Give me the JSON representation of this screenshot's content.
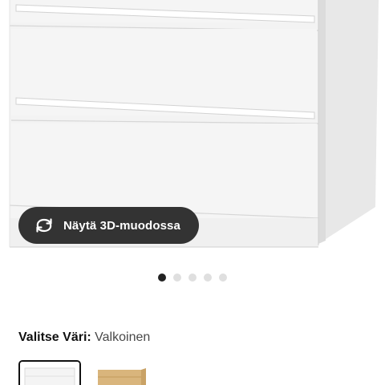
{
  "product_view": {
    "view_3d_label": "Näytä 3D-muodossa",
    "view_3d_icon": "rotate-3d-icon",
    "image_count": 5,
    "active_image_index": 0
  },
  "color_selector": {
    "label": "Valitse Väri:",
    "selected_value": "Valkoinen",
    "options": [
      {
        "icon": "white-chest-swatch-icon",
        "selected": true,
        "color": "#f4f4f4"
      },
      {
        "icon": "oak-chest-swatch-icon",
        "selected": false,
        "color": "#d9b57c"
      }
    ]
  },
  "colors": {
    "button_bg": "#333333",
    "dot_active": "#222222",
    "dot_inactive": "#dfdfdf"
  }
}
